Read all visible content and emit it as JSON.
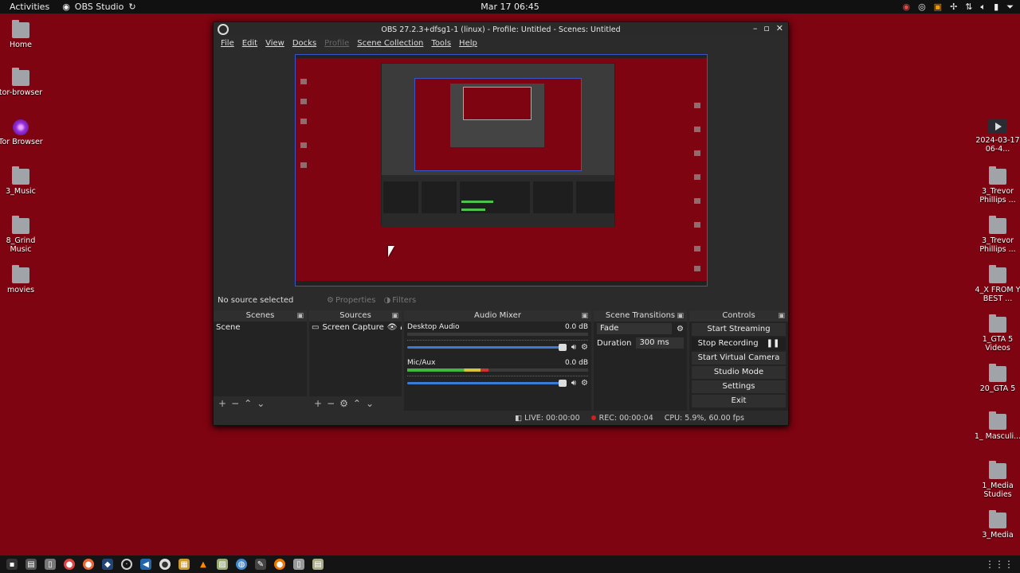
{
  "topbar": {
    "activities": "Activities",
    "app_name": "OBS Studio",
    "clock": "Mar 17  06:45"
  },
  "desktop_left": [
    {
      "label": "Home",
      "kind": "folder"
    },
    {
      "label": "tor-browser",
      "kind": "folder"
    },
    {
      "label": "Tor Browser",
      "kind": "tor"
    },
    {
      "label": "3_Music",
      "kind": "folder"
    },
    {
      "label": "8_Grind Music",
      "kind": "folder"
    },
    {
      "label": "movies",
      "kind": "folder"
    }
  ],
  "desktop_right": [
    {
      "label": "2024-03-17 06-4...",
      "kind": "video"
    },
    {
      "label": "3_Trevor Phillips ...",
      "kind": "folder"
    },
    {
      "label": "3_Trevor Phillips ...",
      "kind": "folder"
    },
    {
      "label": "4_X FROM Y BEST ...",
      "kind": "folder"
    },
    {
      "label": "1_GTA 5 Videos",
      "kind": "folder"
    },
    {
      "label": "20_GTA 5",
      "kind": "folder"
    },
    {
      "label": "1_ Masculi...",
      "kind": "folder"
    },
    {
      "label": "1_Media Studies",
      "kind": "folder"
    },
    {
      "label": "3_Media",
      "kind": "folder"
    }
  ],
  "obs": {
    "title": "OBS 27.2.3+dfsg1-1 (linux) - Profile: Untitled - Scenes: Untitled",
    "menu": [
      "File",
      "Edit",
      "View",
      "Docks",
      "Profile",
      "Scene Collection",
      "Tools",
      "Help"
    ],
    "no_source": "No source selected",
    "properties": "Properties",
    "filters": "Filters",
    "scenes": {
      "header": "Scenes",
      "items": [
        "Scene"
      ]
    },
    "sources": {
      "header": "Sources",
      "items": [
        "Screen Capture"
      ]
    },
    "mixer": {
      "header": "Audio Mixer",
      "channels": [
        {
          "name": "Desktop Audio",
          "db": "0.0 dB",
          "level": 0.0
        },
        {
          "name": "Mic/Aux",
          "db": "0.0 dB",
          "level": 0.45
        }
      ]
    },
    "transitions": {
      "header": "Scene Transitions",
      "selected": "Fade",
      "duration_label": "Duration",
      "duration_value": "300 ms"
    },
    "controls": {
      "header": "Controls",
      "buttons": [
        "Start Streaming",
        "Stop Recording",
        "Start Virtual Camera",
        "Studio Mode",
        "Settings",
        "Exit"
      ]
    },
    "status": {
      "live": "LIVE: 00:00:00",
      "rec": "REC: 00:00:04",
      "cpu": "CPU: 5.9%, 60.00 fps"
    }
  },
  "colors": {
    "desktop_bg": "#7d0410",
    "accent": "#3a55c8",
    "meter_green": "#4ec24e"
  }
}
